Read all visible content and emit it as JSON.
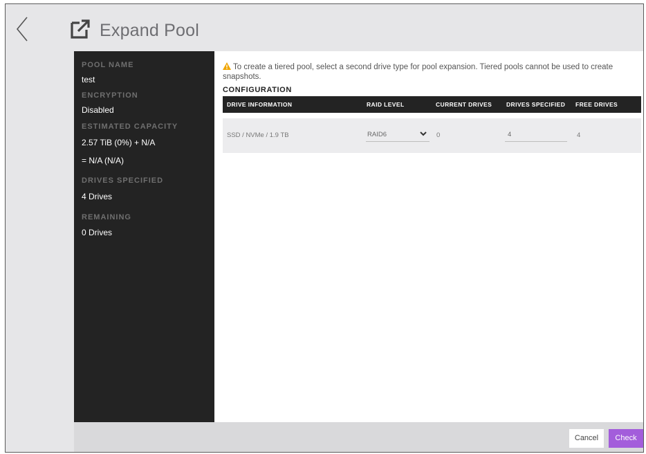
{
  "header": {
    "title": "Expand Pool",
    "back_icon": "chevron-left-icon",
    "title_icon": "external-link-icon"
  },
  "sidebar": {
    "pool_name_label": "POOL NAME",
    "pool_name": "test",
    "encryption_label": "ENCRYPTION",
    "encryption": "Disabled",
    "capacity_label": "ESTIMATED CAPACITY",
    "capacity_line1": "2.57 TiB (0%) + N/A",
    "capacity_line2": "= N/A (N/A)",
    "drives_specified_label": "DRIVES SPECIFIED",
    "drives_specified": "4 Drives",
    "remaining_label": "REMAINING",
    "remaining": "0 Drives"
  },
  "main": {
    "notice": "To create a tiered pool, select a second drive type for pool expansion. Tiered pools cannot be used to create snapshots.",
    "config_title": "CONFIGURATION",
    "columns": [
      "DRIVE INFORMATION",
      "RAID LEVEL",
      "CURRENT DRIVES",
      "DRIVES SPECIFIED",
      "FREE DRIVES"
    ],
    "row": {
      "drive_information": "SSD / NVMe / 1.9 TB",
      "raid_level": "RAID6",
      "current_drives": "0",
      "drives_specified": "4",
      "free_drives": "4"
    }
  },
  "footer": {
    "cancel_label": "Cancel",
    "check_label": "Check"
  },
  "colors": {
    "accent": "#a35ddb",
    "sidebar_bg": "#232323",
    "warning": "#f0a500"
  }
}
